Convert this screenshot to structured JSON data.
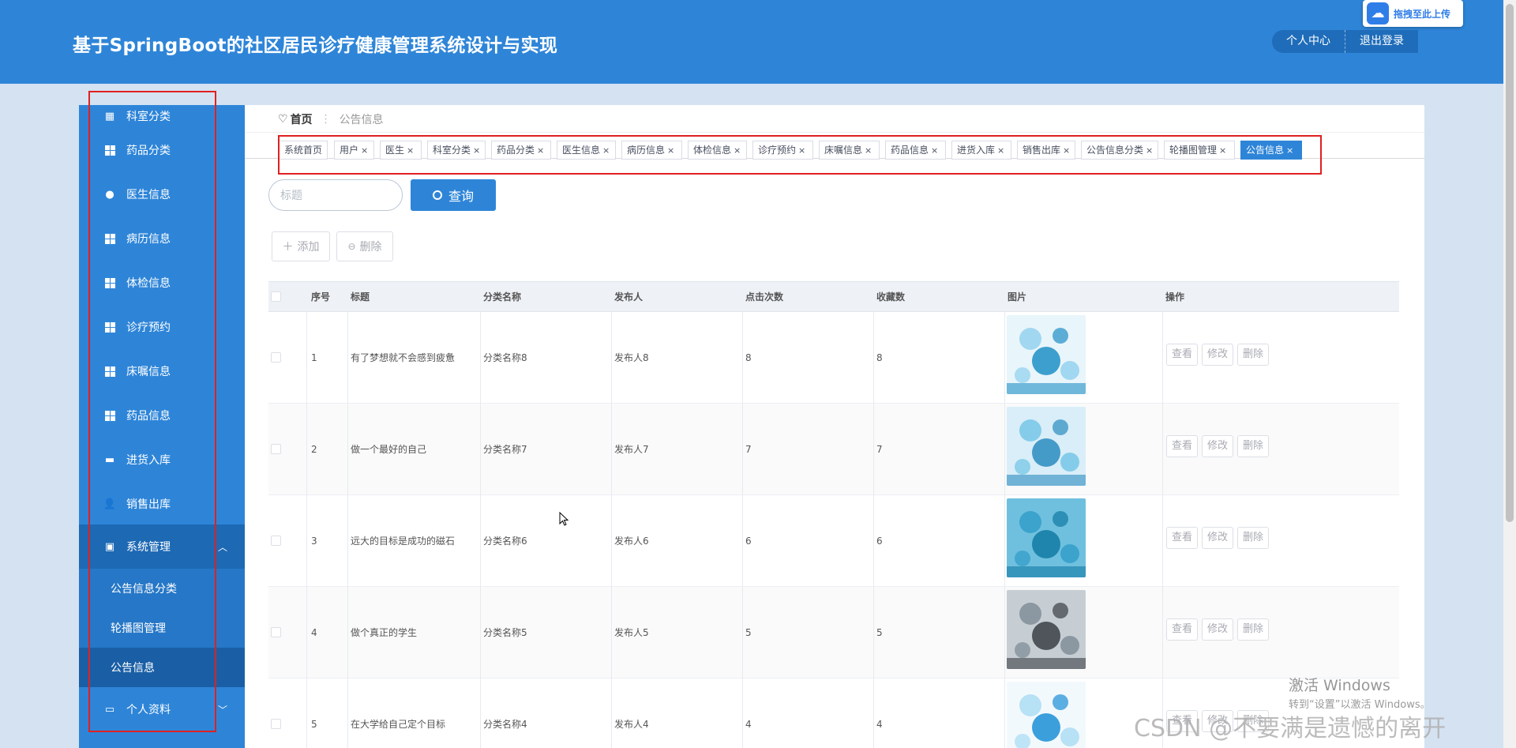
{
  "header": {
    "title": "基于SpringBoot的社区居民诊疗健康管理系统设计与实现",
    "actions": [
      "个人中心",
      "退出登录"
    ],
    "upload_badge": "拖拽至此上传"
  },
  "sidebar": {
    "partial_top": "科室分类",
    "items": [
      "药品分类",
      "医生信息",
      "病历信息",
      "体检信息",
      "诊疗预约",
      "床嘱信息",
      "药品信息",
      "进货入库",
      "销售出库"
    ],
    "group": "系统管理",
    "sub_items": [
      "公告信息分类",
      "轮播图管理",
      "公告信息"
    ],
    "bottom": "个人资料"
  },
  "breadcrumb": {
    "home": "首页",
    "current": "公告信息"
  },
  "tags": [
    {
      "label": "系统首页",
      "closable": false
    },
    {
      "label": "用户",
      "closable": true
    },
    {
      "label": "医生",
      "closable": true
    },
    {
      "label": "科室分类",
      "closable": true
    },
    {
      "label": "药品分类",
      "closable": true
    },
    {
      "label": "医生信息",
      "closable": true
    },
    {
      "label": "病历信息",
      "closable": true
    },
    {
      "label": "体检信息",
      "closable": true
    },
    {
      "label": "诊疗预约",
      "closable": true
    },
    {
      "label": "床嘱信息",
      "closable": true
    },
    {
      "label": "药品信息",
      "closable": true
    },
    {
      "label": "进货入库",
      "closable": true
    },
    {
      "label": "销售出库",
      "closable": true
    },
    {
      "label": "公告信息分类",
      "closable": true
    },
    {
      "label": "轮播图管理",
      "closable": true
    },
    {
      "label": "公告信息",
      "closable": true,
      "active": true
    }
  ],
  "search": {
    "placeholder": "标题",
    "button": "查询"
  },
  "toolbar": {
    "add": "添加",
    "delete": "删除"
  },
  "table": {
    "columns": [
      "序号",
      "标题",
      "分类名称",
      "发布人",
      "点击次数",
      "收藏数",
      "图片",
      "操作"
    ],
    "rows": [
      {
        "index": "1",
        "title": "有了梦想就不会感到疲惫",
        "category": "分类名称8",
        "publisher": "发布人8",
        "clicks": "8",
        "favorites": "8"
      },
      {
        "index": "2",
        "title": "做一个最好的自己",
        "category": "分类名称7",
        "publisher": "发布人7",
        "clicks": "7",
        "favorites": "7"
      },
      {
        "index": "3",
        "title": "远大的目标是成功的磁石",
        "category": "分类名称6",
        "publisher": "发布人6",
        "clicks": "6",
        "favorites": "6"
      },
      {
        "index": "4",
        "title": "做个真正的学生",
        "category": "分类名称5",
        "publisher": "发布人5",
        "clicks": "5",
        "favorites": "5"
      },
      {
        "index": "5",
        "title": "在大学给自己定个目标",
        "category": "分类名称4",
        "publisher": "发布人4",
        "clicks": "4",
        "favorites": "4"
      }
    ],
    "row_actions": [
      "查看",
      "修改",
      "删除"
    ]
  },
  "overlay": {
    "activate_title": "激活 Windows",
    "activate_hint": "转到“设置”以激活 Windows。",
    "csdn": "CSDN @不要满是遗憾的离开"
  },
  "colors": {
    "primary": "#2e85d8",
    "sidebar_active": "#1d69b4",
    "highlight_box": "#e02020"
  }
}
